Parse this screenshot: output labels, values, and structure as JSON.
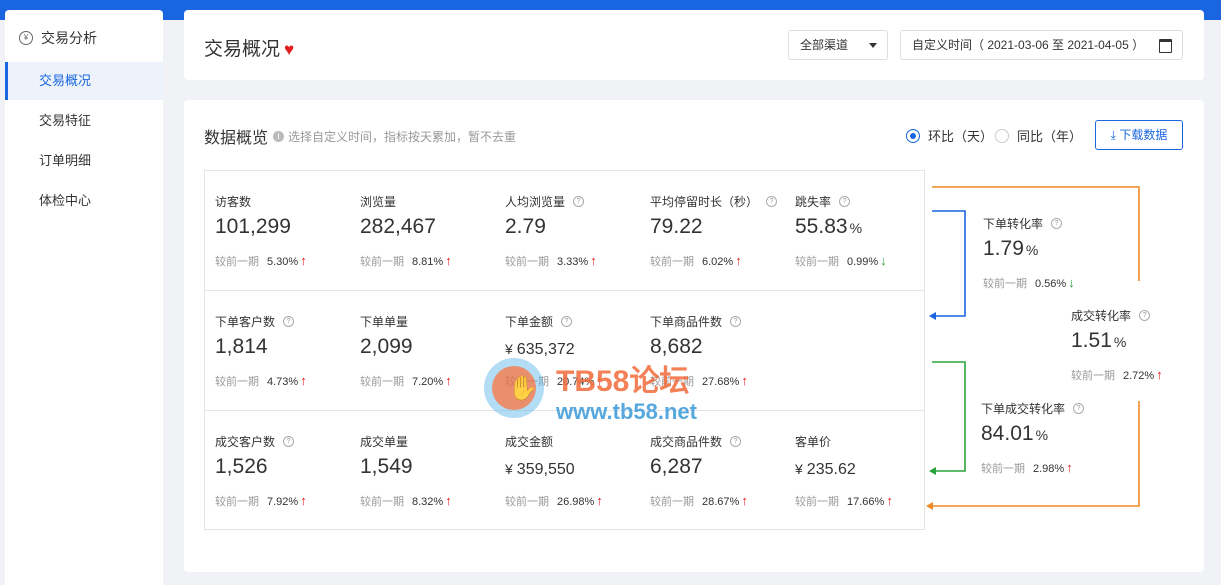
{
  "sidebar": {
    "header": "交易分析",
    "header_icon": "yen-circle-icon",
    "items": [
      {
        "label": "交易概况",
        "active": true
      },
      {
        "label": "交易特征",
        "active": false
      },
      {
        "label": "订单明细",
        "active": false
      },
      {
        "label": "体检中心",
        "active": false
      }
    ]
  },
  "header": {
    "title": "交易概况",
    "channel_select": "全部渠道",
    "date_range": "自定义时间（ 2021-03-06 至 2021-04-05 ）"
  },
  "overview": {
    "title": "数据概览",
    "hint": "选择自定义时间，指标按天累加，暂不去重",
    "radio_day": "环比（天）",
    "radio_year": "同比（年）",
    "download": "下载数据",
    "compare_label": "较前一期",
    "metrics": [
      {
        "label": "访客数",
        "value": "101,299",
        "pct": "5.30%",
        "trend": "up"
      },
      {
        "label": "浏览量",
        "value": "282,467",
        "pct": "8.81%",
        "trend": "up"
      },
      {
        "label": "人均浏览量",
        "value": "2.79",
        "pct": "3.33%",
        "trend": "up"
      },
      {
        "label": "平均停留时长（秒）",
        "value": "79.22",
        "pct": "6.02%",
        "trend": "up"
      },
      {
        "label": "跳失率",
        "value": "55.83",
        "unit": "%",
        "pct": "0.99%",
        "trend": "down"
      },
      {
        "label": "下单客户数",
        "value": "1,814",
        "pct": "4.73%",
        "trend": "up"
      },
      {
        "label": "下单单量",
        "value": "2,099",
        "pct": "7.20%",
        "trend": "up"
      },
      {
        "label": "下单金额",
        "value": "635,372",
        "currency": "¥",
        "pct": "20.74%",
        "trend": "up"
      },
      {
        "label": "下单商品件数",
        "value": "8,682",
        "pct": "27.68%",
        "trend": "up"
      },
      {
        "label": "成交客户数",
        "value": "1,526",
        "pct": "7.92%",
        "trend": "up"
      },
      {
        "label": "成交单量",
        "value": "1,549",
        "pct": "8.32%",
        "trend": "up"
      },
      {
        "label": "成交金额",
        "value": "359,550",
        "currency": "¥",
        "pct": "26.98%",
        "trend": "up"
      },
      {
        "label": "成交商品件数",
        "value": "6,287",
        "pct": "28.67%",
        "trend": "up"
      },
      {
        "label": "客单价",
        "value": "235.62",
        "currency": "¥",
        "pct": "17.66%",
        "trend": "up"
      }
    ],
    "conversion": [
      {
        "label": "下单转化率",
        "value": "1.79",
        "unit": "%",
        "pct": "0.56%",
        "trend": "down"
      },
      {
        "label": "成交转化率",
        "value": "1.51",
        "unit": "%",
        "pct": "2.72%",
        "trend": "up"
      },
      {
        "label": "下单成交转化率",
        "value": "84.01",
        "unit": "%",
        "pct": "2.98%",
        "trend": "up"
      }
    ]
  },
  "watermark": {
    "title": "TB58论坛",
    "url": "www.tb58.net"
  },
  "colors": {
    "accent": "#1a66e0",
    "up": "#e02020",
    "down": "#2aa33a",
    "orange_line": "#f08a24",
    "blue_line": "#1a66e0",
    "green_line": "#2aa33a"
  }
}
